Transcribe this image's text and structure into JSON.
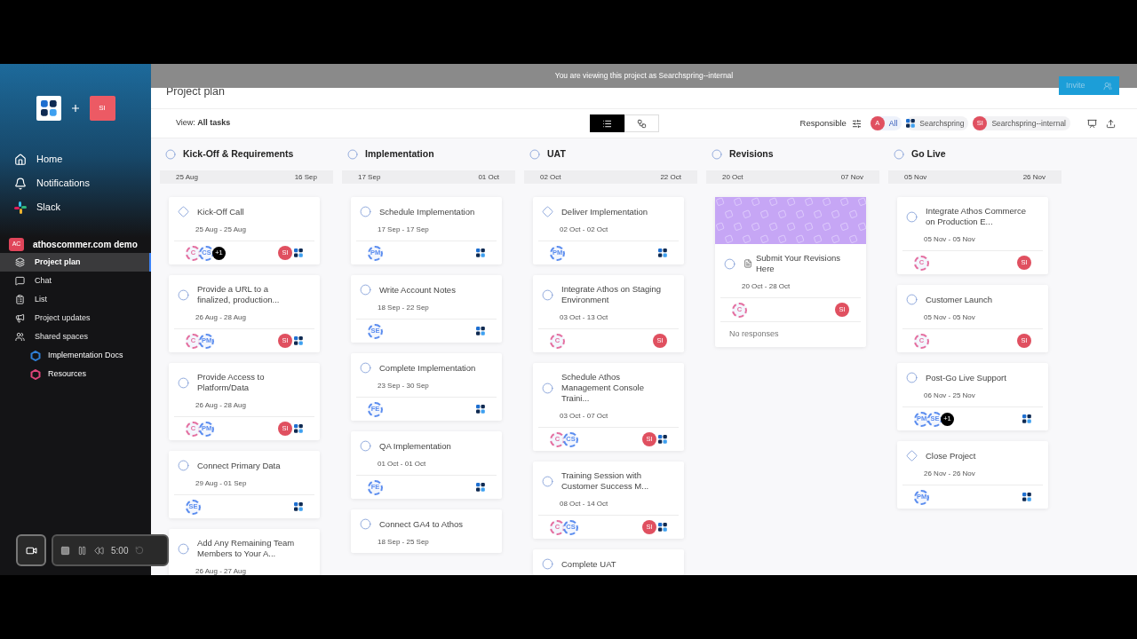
{
  "banner": "You are viewing this project as Searchspring--internal",
  "header": {
    "title": "Project plan",
    "invite": "Invite"
  },
  "sidebar": {
    "partner_badge": "SI",
    "nav": [
      {
        "label": "Home"
      },
      {
        "label": "Notifications"
      },
      {
        "label": "Slack"
      }
    ],
    "workspace": {
      "badge": "AC",
      "name": "athoscommer.com demo"
    },
    "items": [
      {
        "label": "Project plan",
        "selected": true
      },
      {
        "label": "Chat",
        "selected": false
      },
      {
        "label": "List",
        "selected": false
      },
      {
        "label": "Project updates",
        "selected": false
      },
      {
        "label": "Shared spaces",
        "selected": false
      }
    ],
    "shared": [
      {
        "label": "Implementation Docs",
        "color": "#2f7fd6"
      },
      {
        "label": "Resources",
        "color": "#e0457b"
      }
    ]
  },
  "toolbar": {
    "view": "View: **All tasks**",
    "views": [
      {
        "selected": true
      },
      {
        "selected": false
      }
    ],
    "filter_label": "Responsible",
    "chips": [
      {
        "kind": "avatar",
        "badge": "A",
        "label": "All",
        "selected": true
      },
      {
        "kind": "logo",
        "label": "Searchspring",
        "selected": false
      },
      {
        "kind": "avatar",
        "badge": "SI",
        "label": "Searchspring--internal",
        "selected": false
      }
    ]
  },
  "columns": [
    {
      "title": "Kick-Off & Requirements",
      "start": "25 Aug",
      "end": "16 Sep",
      "cards": [
        {
          "kind": "milestone",
          "title": "Kick-Off Call",
          "dates": "25 Aug - 25 Aug",
          "assignees": [
            {
              "initials": "C",
              "color": "#e46fa0"
            },
            {
              "initials": "CS",
              "color": "#5b8def"
            }
          ],
          "more": "+1",
          "owner": "SI",
          "logo": true
        },
        {
          "kind": "task",
          "title": "Provide a URL to a finalized, production...",
          "dates": "26 Aug - 28 Aug",
          "assignees": [
            {
              "initials": "C",
              "color": "#e46fa0"
            },
            {
              "initials": "PM",
              "color": "#5b8def"
            }
          ],
          "owner": "SI",
          "logo": true
        },
        {
          "kind": "task",
          "title": "Provide Access to Platform/Data",
          "dates": "26 Aug - 28 Aug",
          "assignees": [
            {
              "initials": "C",
              "color": "#e46fa0"
            },
            {
              "initials": "PM",
              "color": "#5b8def"
            }
          ],
          "owner": "SI",
          "logo": true
        },
        {
          "kind": "task",
          "title": "Connect Primary Data",
          "dates": "29 Aug - 01 Sep",
          "assignees": [
            {
              "initials": "SE",
              "color": "#5b8def"
            }
          ],
          "logo": true
        },
        {
          "kind": "task",
          "title": "Add Any Remaining Team Members to Your A...",
          "dates": "26 Aug - 27 Aug",
          "logo": false
        }
      ]
    },
    {
      "title": "Implementation",
      "start": "17 Sep",
      "end": "01 Oct",
      "cards": [
        {
          "kind": "task",
          "title": "Schedule Implementation",
          "dates": "17 Sep - 17 Sep",
          "assignees": [
            {
              "initials": "PM",
              "color": "#5b8def"
            }
          ],
          "logo": true
        },
        {
          "kind": "task",
          "title": "Write Account Notes",
          "dates": "18 Sep - 22 Sep",
          "assignees": [
            {
              "initials": "SE",
              "color": "#5b8def"
            }
          ],
          "logo": true
        },
        {
          "kind": "task",
          "title": "Complete Implementation",
          "dates": "23 Sep - 30 Sep",
          "assignees": [
            {
              "initials": "FE",
              "color": "#5b8def"
            }
          ],
          "logo": true
        },
        {
          "kind": "task",
          "title": "QA Implementation",
          "dates": "01 Oct - 01 Oct",
          "assignees": [
            {
              "initials": "FE",
              "color": "#5b8def"
            }
          ],
          "logo": true
        },
        {
          "kind": "task",
          "title": "Connect GA4 to Athos",
          "dates": "18 Sep - 25 Sep",
          "logo": false
        }
      ]
    },
    {
      "title": "UAT",
      "start": "02 Oct",
      "end": "22 Oct",
      "cards": [
        {
          "kind": "milestone",
          "title": "Deliver Implementation",
          "dates": "02 Oct - 02 Oct",
          "assignees": [
            {
              "initials": "PM",
              "color": "#5b8def"
            }
          ],
          "logo": true
        },
        {
          "kind": "task",
          "title": "Integrate Athos on Staging Environment",
          "dates": "03 Oct - 13 Oct",
          "assignees": [
            {
              "initials": "C",
              "color": "#e46fa0"
            }
          ],
          "owner": "SI",
          "logo": false
        },
        {
          "kind": "task",
          "title": "Schedule Athos Management Console Traini...",
          "dates": "03 Oct - 07 Oct",
          "assignees": [
            {
              "initials": "C",
              "color": "#e46fa0"
            },
            {
              "initials": "CS",
              "color": "#5b8def"
            }
          ],
          "owner": "SI",
          "logo": true
        },
        {
          "kind": "task",
          "title": "Training Session with Customer Success M...",
          "dates": "08 Oct - 14 Oct",
          "assignees": [
            {
              "initials": "C",
              "color": "#e46fa0"
            },
            {
              "initials": "CS",
              "color": "#5b8def"
            }
          ],
          "owner": "SI",
          "logo": true
        },
        {
          "kind": "task",
          "title": "Complete UAT",
          "logo": false
        }
      ]
    },
    {
      "title": "Revisions",
      "start": "20 Oct",
      "end": "07 Nov",
      "cards": [
        {
          "kind": "task",
          "cover": true,
          "doc": true,
          "title": "Submit Your Revisions Here",
          "dates": "20 Oct - 28 Oct",
          "assignees": [
            {
              "initials": "C",
              "color": "#e46fa0"
            }
          ],
          "owner": "SI",
          "logo": false,
          "note": "No responses"
        }
      ]
    },
    {
      "title": "Go Live",
      "start": "05 Nov",
      "end": "26 Nov",
      "cards": [
        {
          "kind": "task",
          "title": "Integrate Athos Commerce on Production E...",
          "dates": "05 Nov - 05 Nov",
          "assignees": [
            {
              "initials": "C",
              "color": "#e46fa0"
            }
          ],
          "owner": "SI",
          "logo": false
        },
        {
          "kind": "task",
          "title": "Customer Launch",
          "dates": "05 Nov - 05 Nov",
          "assignees": [
            {
              "initials": "C",
              "color": "#e46fa0"
            }
          ],
          "owner": "SI",
          "logo": false
        },
        {
          "kind": "task",
          "title": "Post-Go Live Support",
          "dates": "06 Nov - 25 Nov",
          "assignees": [
            {
              "initials": "PM",
              "color": "#5b8def"
            },
            {
              "initials": "SE",
              "color": "#5b8def"
            }
          ],
          "more": "+1",
          "logo": true
        },
        {
          "kind": "milestone",
          "title": "Close Project",
          "dates": "26 Nov - 26 Nov",
          "assignees": [
            {
              "initials": "PM",
              "color": "#5b8def"
            }
          ],
          "logo": true
        }
      ]
    }
  ],
  "recorder": {
    "time": "5:00"
  }
}
